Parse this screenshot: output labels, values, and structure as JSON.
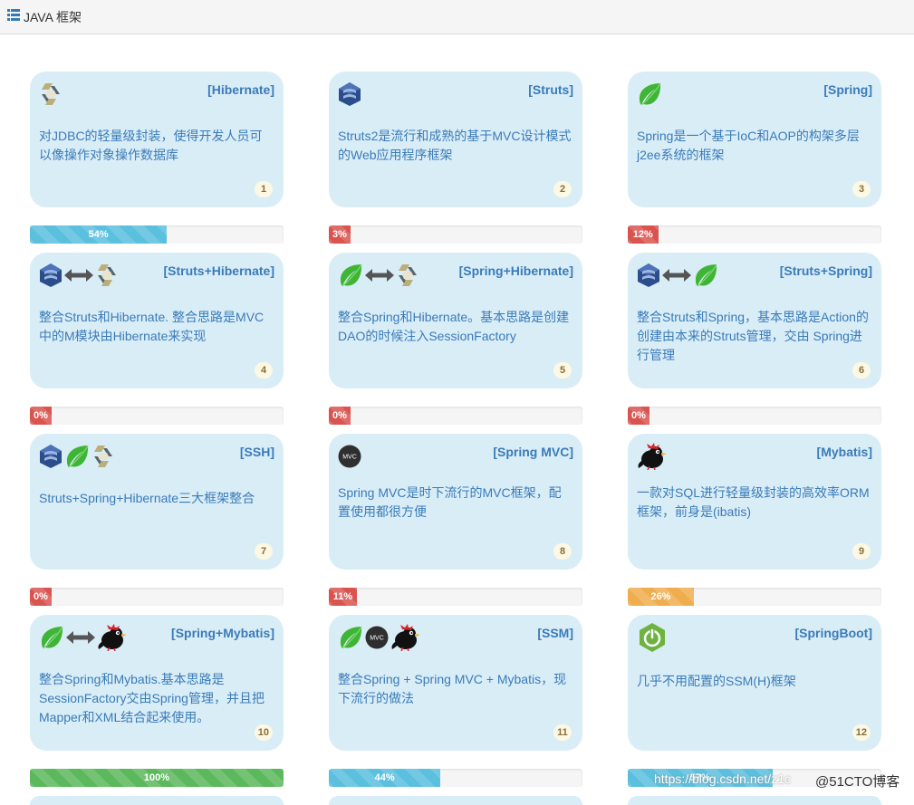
{
  "header": {
    "title": "JAVA 框架",
    "icon": "list-icon"
  },
  "cards": [
    {
      "title": "[Hibernate]",
      "desc": "对JDBC的轻量级封装，使得开发人员可以像操作对象操作数据库",
      "badge": "1",
      "icons": [
        "hibernate-icon"
      ],
      "progress": {
        "label": "54%",
        "value": 54,
        "style": "info"
      }
    },
    {
      "title": "[Struts]",
      "desc": "Struts2是流行和成熟的基于MVC设计模式的Web应用程序框架",
      "badge": "2",
      "icons": [
        "struts-icon"
      ],
      "progress": {
        "label": "3%",
        "value": 3,
        "style": "danger"
      }
    },
    {
      "title": "[Spring]",
      "desc": "Spring是一个基于IoC和AOP的构架多层j2ee系统的框架",
      "badge": "3",
      "icons": [
        "spring-leaf-icon"
      ],
      "progress": {
        "label": "12%",
        "value": 12,
        "style": "danger"
      }
    },
    {
      "title": "[Struts+Hibernate]",
      "desc": "整合Struts和Hibernate. 整合思路是MVC中的M模块由Hibernate来实现",
      "badge": "4",
      "icons": [
        "struts-icon",
        "double-arrow-icon",
        "hibernate-icon"
      ],
      "progress": {
        "label": "0%",
        "value": 0,
        "style": "danger"
      }
    },
    {
      "title": "[Spring+Hibernate]",
      "desc": "整合Spring和Hibernate。基本思路是创建DAO的时候注入SessionFactory",
      "badge": "5",
      "icons": [
        "spring-leaf-icon",
        "double-arrow-icon",
        "hibernate-icon"
      ],
      "progress": {
        "label": "0%",
        "value": 0,
        "style": "danger"
      }
    },
    {
      "title": "[Struts+Spring]",
      "desc": "整合Struts和Spring，基本思路是Action的创建由本来的Struts管理，交由 Spring进行管理",
      "badge": "6",
      "icons": [
        "struts-icon",
        "double-arrow-icon",
        "spring-leaf-icon"
      ],
      "progress": {
        "label": "0%",
        "value": 0,
        "style": "danger"
      }
    },
    {
      "title": "[SSH]",
      "desc": "Struts+Spring+Hibernate三大框架整合",
      "badge": "7",
      "icons": [
        "struts-icon",
        "spring-leaf-icon",
        "hibernate-icon"
      ],
      "progress": {
        "label": "0%",
        "value": 0,
        "style": "danger"
      }
    },
    {
      "title": "[Spring MVC]",
      "desc": "Spring MVC是时下流行的MVC框架，配置使用都很方便",
      "badge": "8",
      "icons": [
        "mvc-icon"
      ],
      "mvc_text": "MVC",
      "progress": {
        "label": "11%",
        "value": 11,
        "style": "danger"
      }
    },
    {
      "title": "[Mybatis]",
      "desc": "一款对SQL进行轻量级封装的高效率ORM框架，前身是(ibatis)",
      "badge": "9",
      "icons": [
        "mybatis-bird-icon"
      ],
      "progress": {
        "label": "26%",
        "value": 26,
        "style": "warning"
      }
    },
    {
      "title": "[Spring+Mybatis]",
      "desc": "整合Spring和Mybatis.基本思路是SessionFactory交由Spring管理，并且把Mapper和XML结合起来使用。",
      "badge": "10",
      "icons": [
        "spring-leaf-icon",
        "double-arrow-icon",
        "mybatis-bird-icon"
      ],
      "progress": {
        "label": "100%",
        "value": 100,
        "style": "success"
      }
    },
    {
      "title": "[SSM]",
      "desc": "整合Spring + Spring MVC + Mybatis，现下流行的做法",
      "badge": "11",
      "icons": [
        "spring-leaf-icon",
        "mvc-icon",
        "mybatis-bird-icon"
      ],
      "mvc_text": "MVC",
      "progress": {
        "label": "44%",
        "value": 44,
        "style": "info"
      }
    },
    {
      "title": "[SpringBoot]",
      "desc": "几乎不用配置的SSM(H)框架",
      "badge": "12",
      "icons": [
        "springboot-icon"
      ],
      "progress": {
        "label": "57%",
        "value": 57,
        "style": "info"
      }
    }
  ],
  "watermark": {
    "url": "https://blog.csdn.net/z1c",
    "site": "@51CTO博客"
  },
  "colors": {
    "card_bg": "#d9edf7",
    "title": "#3a7bb8",
    "info": "#5bc0de",
    "danger": "#d9534f",
    "warning": "#f0ad4e",
    "success": "#5cb85c"
  }
}
